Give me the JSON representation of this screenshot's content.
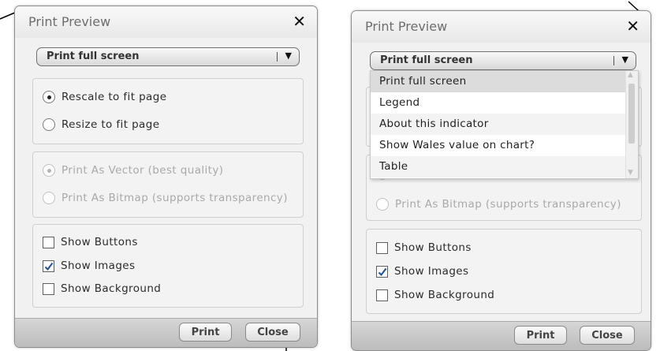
{
  "dialogs": [
    {
      "title": "Print Preview",
      "select_value": "Print full screen",
      "scale_options": [
        {
          "label": "Rescale to fit page",
          "checked": true
        },
        {
          "label": "Resize to fit page",
          "checked": false
        }
      ],
      "format_options": [
        {
          "label": "Print As Vector (best quality)",
          "checked": true
        },
        {
          "label": "Print As Bitmap (supports transparency)",
          "checked": false
        }
      ],
      "show_options": [
        {
          "label": "Show Buttons",
          "checked": false
        },
        {
          "label": "Show Images",
          "checked": true
        },
        {
          "label": "Show Background",
          "checked": false
        }
      ],
      "print_label": "Print",
      "close_label": "Close"
    },
    {
      "title": "Print Preview",
      "select_value": "Print full screen",
      "dropdown_options": [
        "Print full screen",
        "Legend",
        "About this indicator",
        "Show Wales value on chart?",
        "Table"
      ],
      "dropdown_selected": 0,
      "format_options": [
        {
          "label": "Print As Bitmap (supports transparency)",
          "checked": false
        }
      ],
      "show_options": [
        {
          "label": "Show Buttons",
          "checked": false
        },
        {
          "label": "Show Images",
          "checked": true
        },
        {
          "label": "Show Background",
          "checked": false
        }
      ],
      "print_label": "Print",
      "close_label": "Close"
    }
  ],
  "icons": {
    "close": "✕",
    "dropdown_arrow": "▼",
    "scroll_up": "▲",
    "scroll_down": "▼",
    "checkmark": "check-icon"
  },
  "colors": {
    "dialog_bg": "#f1f1f1",
    "footer_bg": "#c9c9c9",
    "disabled_text": "#a9a9a9",
    "check_color": "#1c4f9c"
  }
}
